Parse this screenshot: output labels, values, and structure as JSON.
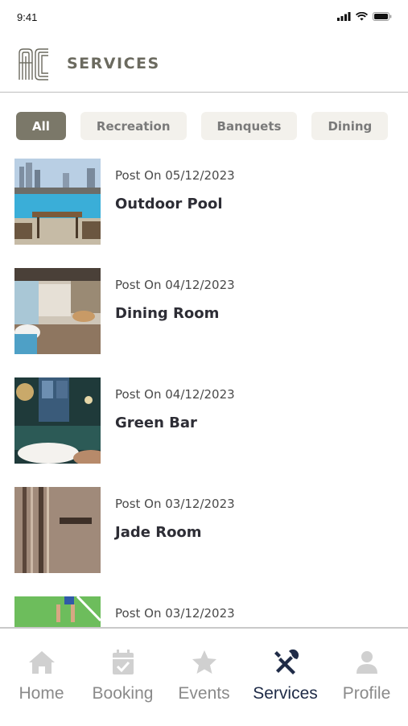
{
  "status_bar": {
    "time": "9:41"
  },
  "header": {
    "title": "SERVICES"
  },
  "filters": [
    {
      "label": "All",
      "active": true
    },
    {
      "label": "Recreation",
      "active": false
    },
    {
      "label": "Banquets",
      "active": false
    },
    {
      "label": "Dining",
      "active": false
    }
  ],
  "items": [
    {
      "date": "Post On 05/12/2023",
      "name": "Outdoor Pool"
    },
    {
      "date": "Post On 04/12/2023",
      "name": "Dining Room"
    },
    {
      "date": "Post On 04/12/2023",
      "name": "Green Bar"
    },
    {
      "date": "Post On 03/12/2023",
      "name": "Jade Room"
    },
    {
      "date": "Post On 03/12/2023",
      "name": ""
    }
  ],
  "tabs": [
    {
      "label": "Home",
      "icon": "home-icon"
    },
    {
      "label": "Booking",
      "icon": "calendar-check-icon"
    },
    {
      "label": "Events",
      "icon": "star-icon"
    },
    {
      "label": "Services",
      "icon": "tools-icon",
      "active": true
    },
    {
      "label": "Profile",
      "icon": "person-icon"
    }
  ],
  "colors": {
    "accent": "#7b7869",
    "active_tab": "#1f2b47",
    "inactive": "#8a8a8a"
  }
}
